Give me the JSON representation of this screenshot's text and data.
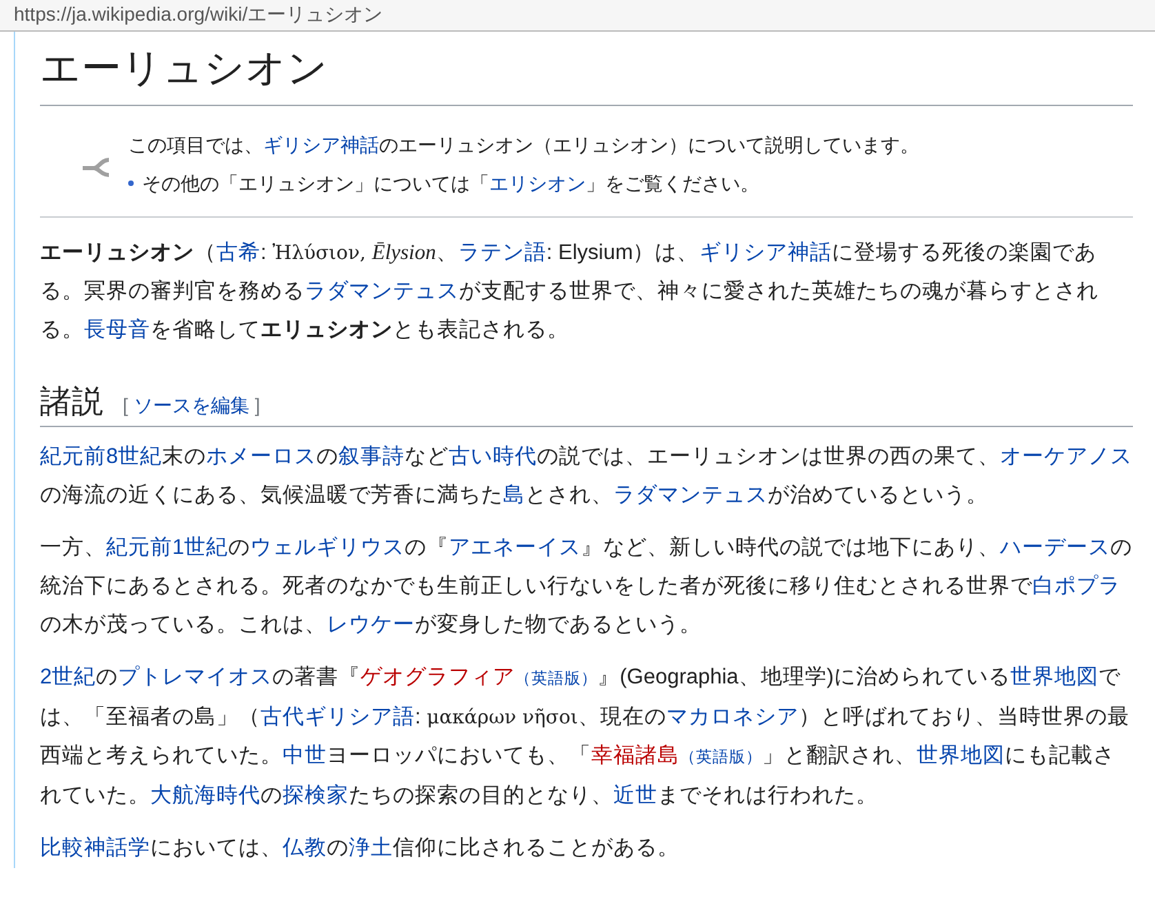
{
  "address_bar": {
    "url": "https://ja.wikipedia.org/wiki/エーリュシオン"
  },
  "title": "エーリュシオン",
  "hatnote": {
    "line": [
      {
        "kind": "text",
        "t": "この項目では、"
      },
      {
        "kind": "link",
        "t": "ギリシア神話"
      },
      {
        "kind": "text",
        "t": "のエーリュシオン（エリュシオン）について説明しています。"
      }
    ],
    "items": [
      [
        {
          "kind": "text",
          "t": "その他の「エリュシオン」については「"
        },
        {
          "kind": "link",
          "t": "エリシオン"
        },
        {
          "kind": "text",
          "t": "」をご覧ください。"
        }
      ]
    ]
  },
  "lead": [
    [
      {
        "kind": "bold",
        "t": "エーリュシオン"
      },
      {
        "kind": "text",
        "t": "（"
      },
      {
        "kind": "link",
        "t": "古希"
      },
      {
        "kind": "text",
        "t": ": "
      },
      {
        "kind": "greek",
        "t": "Ἠλύσιον"
      },
      {
        "kind": "greek",
        "t": ", "
      },
      {
        "kind": "italic",
        "t": "Ēlysion"
      },
      {
        "kind": "text",
        "t": "、"
      },
      {
        "kind": "link",
        "t": "ラテン語"
      },
      {
        "kind": "text",
        "t": ": Elysium）は、"
      },
      {
        "kind": "link",
        "t": "ギリシア神話"
      },
      {
        "kind": "text",
        "t": "に登場する死後の楽園である。冥界の審判官を務める"
      },
      {
        "kind": "link",
        "t": "ラダマンテュス"
      },
      {
        "kind": "text",
        "t": "が支配する世界で、神々に愛された英雄たちの魂が暮らすとされる。"
      },
      {
        "kind": "link",
        "t": "長母音"
      },
      {
        "kind": "text",
        "t": "を省略して"
      },
      {
        "kind": "bold",
        "t": "エリュシオン"
      },
      {
        "kind": "text",
        "t": "とも表記される。"
      }
    ]
  ],
  "section": {
    "heading": "諸説",
    "edit_link": {
      "open": "[",
      "label": "ソースを編集",
      "close": "]"
    }
  },
  "paragraphs": [
    [
      {
        "kind": "link",
        "t": "紀元前8世紀"
      },
      {
        "kind": "text",
        "t": "末の"
      },
      {
        "kind": "link",
        "t": "ホメーロス"
      },
      {
        "kind": "text",
        "t": "の"
      },
      {
        "kind": "link",
        "t": "叙事詩"
      },
      {
        "kind": "text",
        "t": "など"
      },
      {
        "kind": "link",
        "t": "古い時代"
      },
      {
        "kind": "text",
        "t": "の説では、エーリュシオンは世界の西の果て、"
      },
      {
        "kind": "link",
        "t": "オーケアノス"
      },
      {
        "kind": "text",
        "t": "の海流の近くにある、気候温暖で芳香に満ちた"
      },
      {
        "kind": "link",
        "t": "島"
      },
      {
        "kind": "text",
        "t": "とされ、"
      },
      {
        "kind": "link",
        "t": "ラダマンテュス"
      },
      {
        "kind": "text",
        "t": "が治めているという。"
      }
    ],
    [
      {
        "kind": "text",
        "t": "一方、"
      },
      {
        "kind": "link",
        "t": "紀元前1世紀"
      },
      {
        "kind": "text",
        "t": "の"
      },
      {
        "kind": "link",
        "t": "ウェルギリウス"
      },
      {
        "kind": "text",
        "t": "の『"
      },
      {
        "kind": "link",
        "t": "アエネーイス"
      },
      {
        "kind": "text",
        "t": "』など、新しい時代の説では地下にあり、"
      },
      {
        "kind": "link",
        "t": "ハーデース"
      },
      {
        "kind": "text",
        "t": "の統治下にあるとされる。死者のなかでも生前正しい行ないをした者が死後に移り住むとされる世界で"
      },
      {
        "kind": "link",
        "t": "白ポプラ"
      },
      {
        "kind": "text",
        "t": "の木が茂っている。これは、"
      },
      {
        "kind": "link",
        "t": "レウケー"
      },
      {
        "kind": "text",
        "t": "が変身した物であるという。"
      }
    ],
    [
      {
        "kind": "link",
        "t": "2世紀"
      },
      {
        "kind": "text",
        "t": "の"
      },
      {
        "kind": "link",
        "t": "プトレマイオス"
      },
      {
        "kind": "text",
        "t": "の著書『"
      },
      {
        "kind": "redlink",
        "t": "ゲオグラフィア"
      },
      {
        "kind": "note",
        "t": "（英語版）"
      },
      {
        "kind": "text",
        "t": "』(Geographia、地理学)に治められている"
      },
      {
        "kind": "link",
        "t": "世界地図"
      },
      {
        "kind": "text",
        "t": "では、「至福者の島」（"
      },
      {
        "kind": "link",
        "t": "古代ギリシア語"
      },
      {
        "kind": "text",
        "t": ": "
      },
      {
        "kind": "greek",
        "t": "μακάρων νῆσοι"
      },
      {
        "kind": "text",
        "t": "、現在の"
      },
      {
        "kind": "link",
        "t": "マカロネシア"
      },
      {
        "kind": "text",
        "t": "）と呼ばれており、当時世界の最西端と考えられていた。"
      },
      {
        "kind": "link",
        "t": "中世"
      },
      {
        "kind": "text",
        "t": "ヨーロッパにおいても、「"
      },
      {
        "kind": "redlink",
        "t": "幸福諸島"
      },
      {
        "kind": "note",
        "t": "（英語版）"
      },
      {
        "kind": "text",
        "t": "」と翻訳され、"
      },
      {
        "kind": "link",
        "t": "世界地図"
      },
      {
        "kind": "text",
        "t": "にも記載されていた。"
      },
      {
        "kind": "link",
        "t": "大航海時代"
      },
      {
        "kind": "text",
        "t": "の"
      },
      {
        "kind": "link",
        "t": "探検家"
      },
      {
        "kind": "text",
        "t": "たちの探索の目的となり、"
      },
      {
        "kind": "link",
        "t": "近世"
      },
      {
        "kind": "text",
        "t": "までそれは行われた。"
      }
    ],
    [
      {
        "kind": "link",
        "t": "比較神話学"
      },
      {
        "kind": "text",
        "t": "においては、"
      },
      {
        "kind": "link",
        "t": "仏教"
      },
      {
        "kind": "text",
        "t": "の"
      },
      {
        "kind": "link",
        "t": "浄土"
      },
      {
        "kind": "text",
        "t": "信仰に比されることがある。"
      }
    ]
  ]
}
